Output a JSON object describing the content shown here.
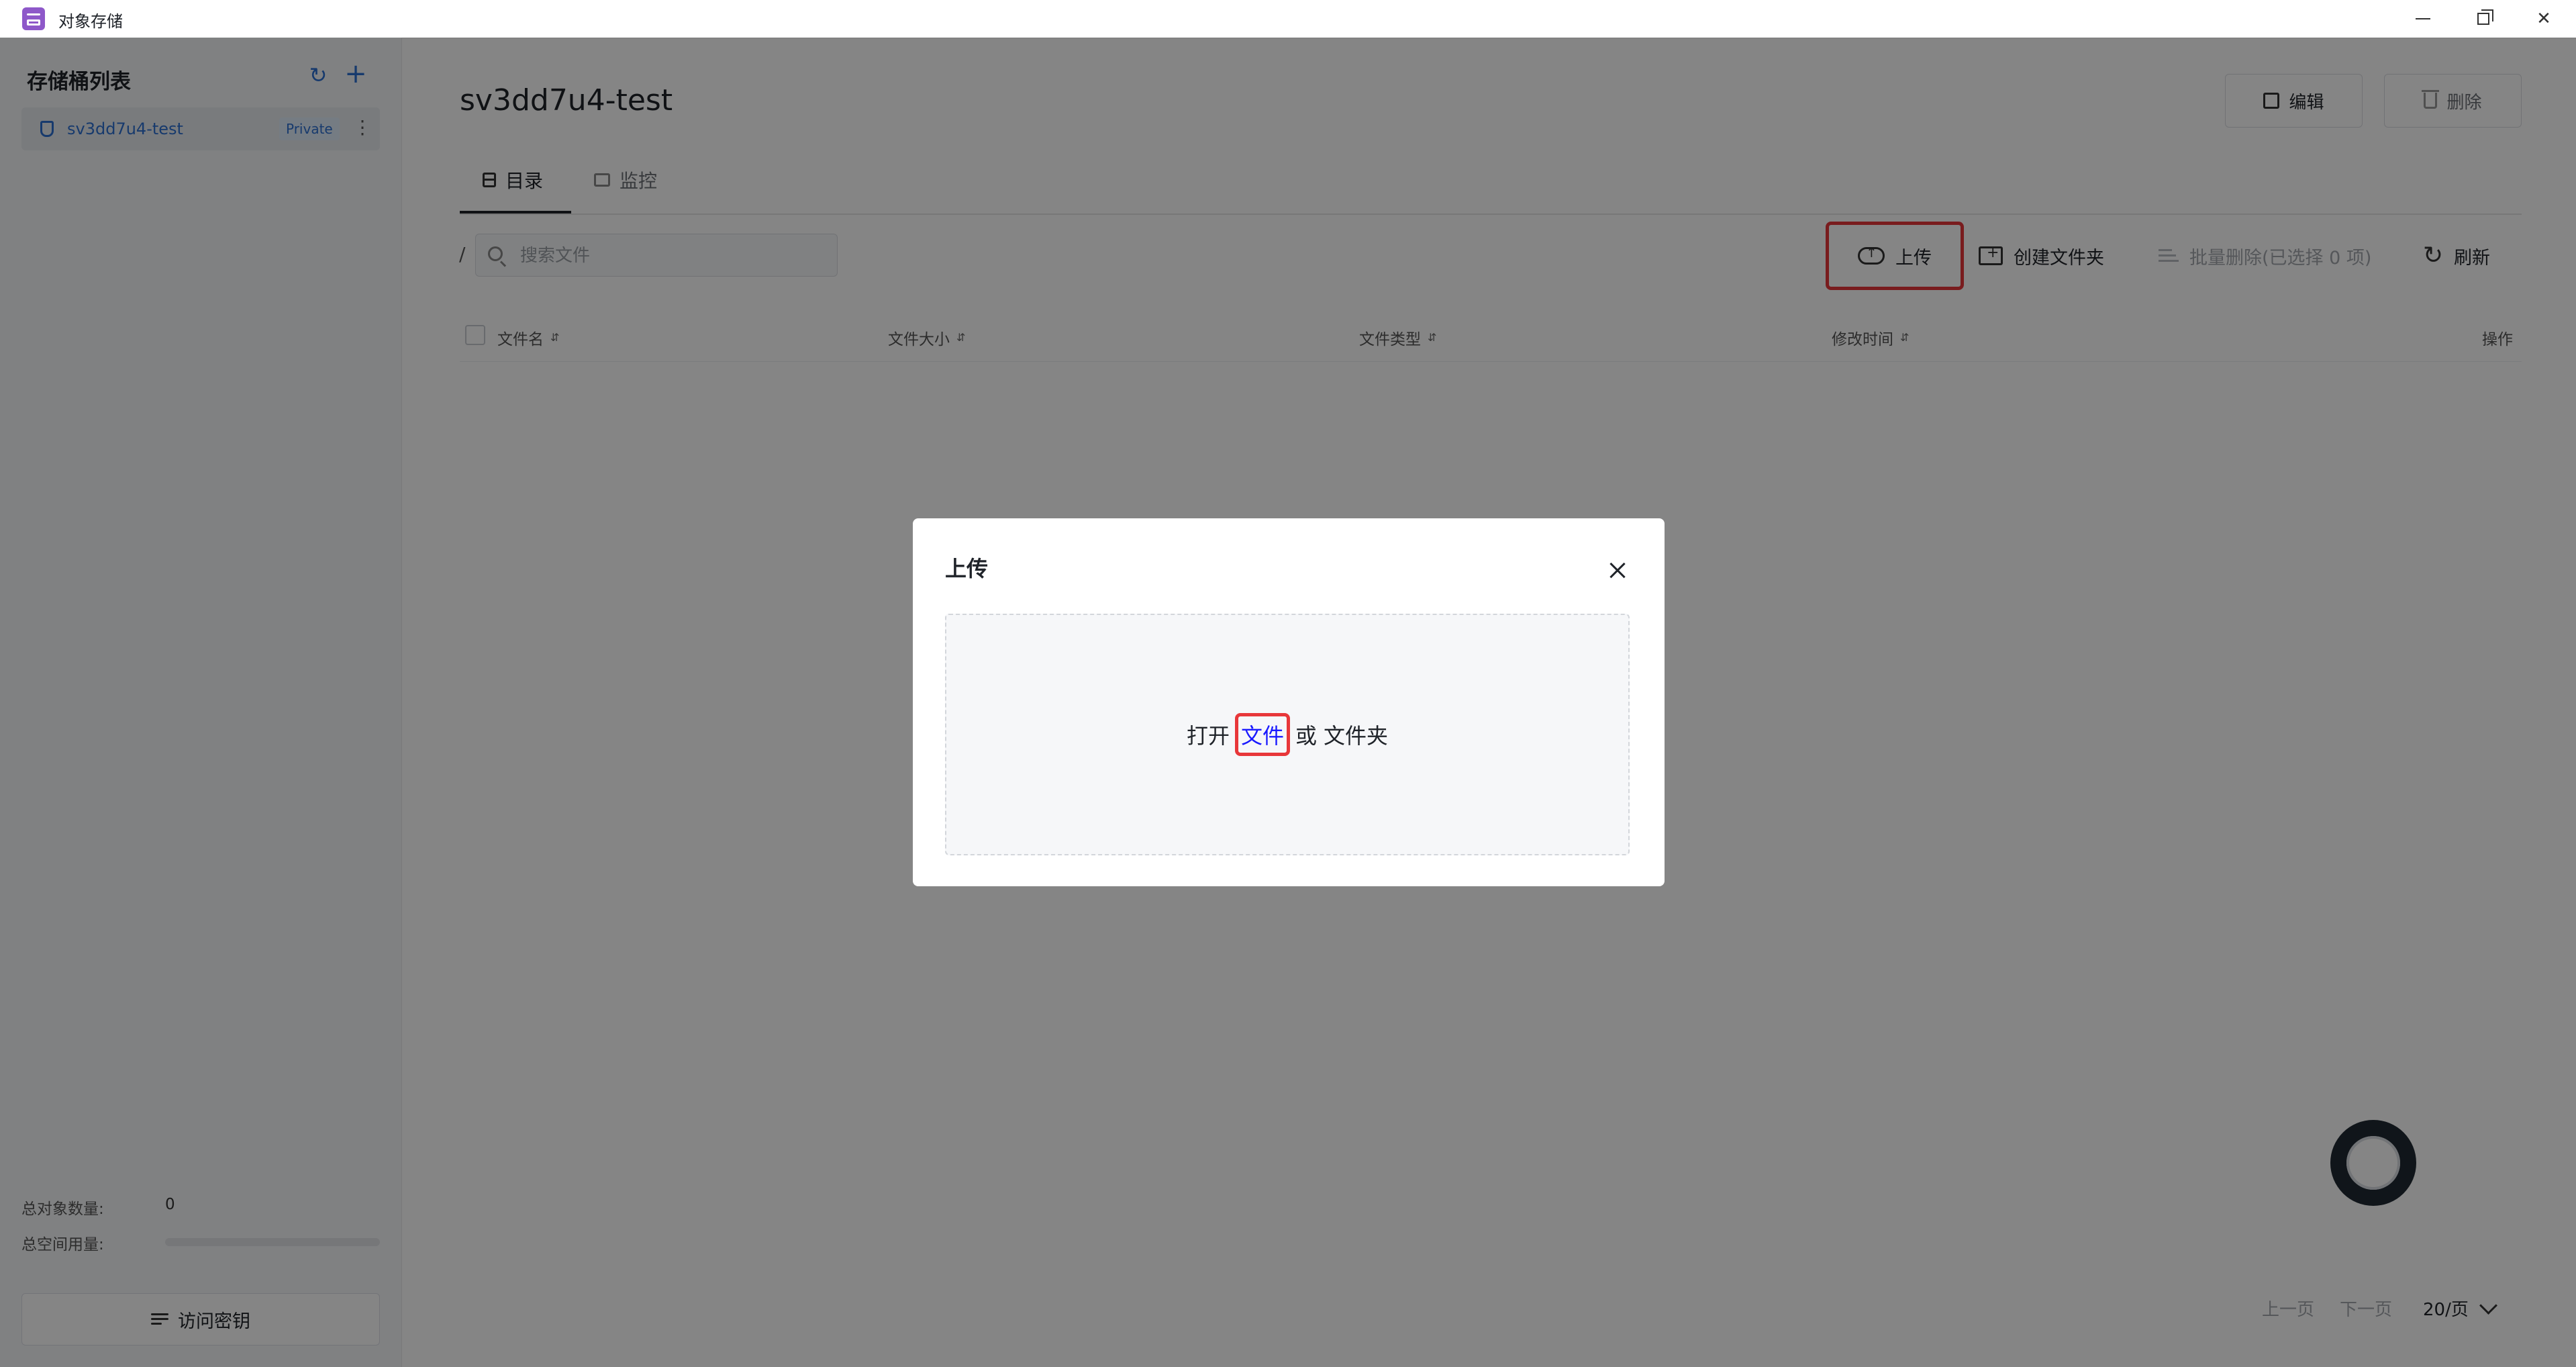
{
  "window": {
    "title": "对象存储"
  },
  "sidebar": {
    "title": "存储桶列表",
    "buckets": [
      {
        "name": "sv3dd7u4-test",
        "badge": "Private"
      }
    ],
    "stats": {
      "object_count_label": "总对象数量:",
      "object_count_value": "0",
      "space_usage_label": "总空间用量:",
      "space_usage_fraction": 0
    },
    "access_key_label": "访问密钥"
  },
  "main": {
    "bucket_title": "sv3dd7u4-test",
    "edit_label": "编辑",
    "delete_label": "删除",
    "tabs": [
      {
        "label": "目录"
      },
      {
        "label": "监控"
      }
    ],
    "path": "/",
    "search_placeholder": "搜索文件",
    "toolbar": {
      "upload": "上传",
      "new_folder": "创建文件夹",
      "batch_delete": "批量删除(已选择 0 项)",
      "refresh": "刷新"
    },
    "table": {
      "columns": [
        "文件名",
        "文件大小",
        "文件类型",
        "修改时间",
        "操作"
      ]
    },
    "pagination": {
      "prev": "上一页",
      "next": "下一页",
      "page_size": "20/页"
    }
  },
  "upload_dialog": {
    "title": "上传",
    "open_text": "打开",
    "file_link": "文件",
    "or_text": "或",
    "folder_link": "文件夹"
  },
  "colors": {
    "accent": "#2c6fd1",
    "highlight": "#e8373a",
    "link": "#1a1aff",
    "app_icon": "#8e58c9"
  }
}
